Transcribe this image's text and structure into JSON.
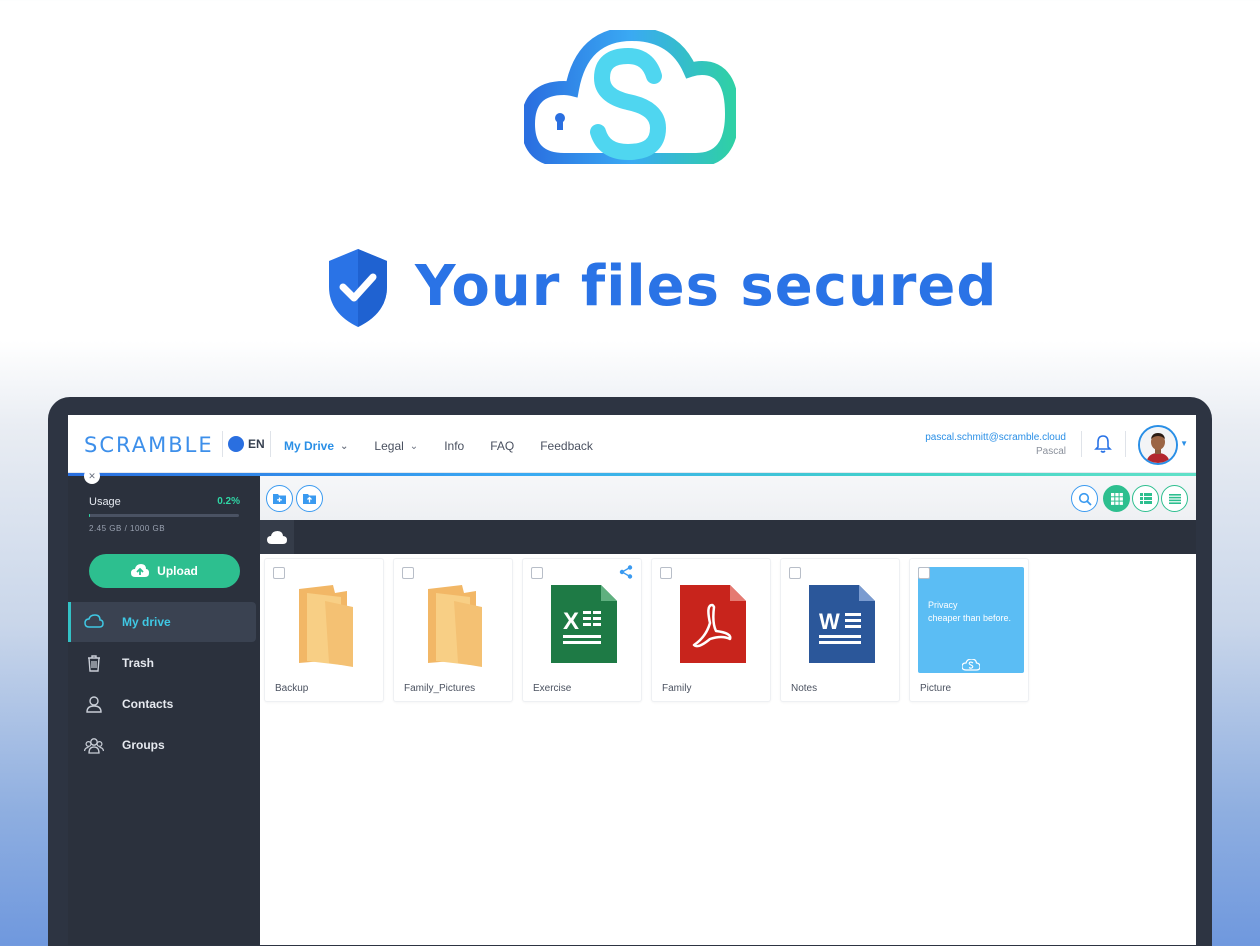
{
  "hero": {
    "title": "Your files secured"
  },
  "topbar": {
    "brand": "SCRAMBLE",
    "language": "EN",
    "nav": [
      {
        "label": "My Drive",
        "active": true,
        "dropdown": true
      },
      {
        "label": "Legal",
        "active": false,
        "dropdown": true
      },
      {
        "label": "Info",
        "active": false,
        "dropdown": false
      },
      {
        "label": "FAQ",
        "active": false,
        "dropdown": false
      },
      {
        "label": "Feedback",
        "active": false,
        "dropdown": false
      }
    ],
    "user_email": "pascal.schmitt@scramble.cloud",
    "user_name": "Pascal"
  },
  "sidebar": {
    "usage_label": "Usage",
    "usage_percent": "0.2%",
    "usage_fraction": 0.002,
    "usage_size": "2.45 GB / 1000 GB",
    "upload_label": "Upload",
    "items": [
      {
        "label": "My drive",
        "icon": "cloud-icon",
        "active": true
      },
      {
        "label": "Trash",
        "icon": "trash-icon",
        "active": false
      },
      {
        "label": "Contacts",
        "icon": "user-icon",
        "active": false
      },
      {
        "label": "Groups",
        "icon": "group-icon",
        "active": false
      }
    ]
  },
  "files": [
    {
      "name": "Backup",
      "type": "folder",
      "icon": "folder-icon"
    },
    {
      "name": "Family_Pictures",
      "type": "folder",
      "icon": "folder-icon"
    },
    {
      "name": "Exercise",
      "type": "excel",
      "icon": "excel-icon",
      "shared": true
    },
    {
      "name": "Family",
      "type": "pdf",
      "icon": "pdf-icon"
    },
    {
      "name": "Notes",
      "type": "word",
      "icon": "word-icon"
    },
    {
      "name": "Picture",
      "type": "image",
      "icon": "image-thumb"
    }
  ],
  "picture_text": {
    "line1": "Privacy",
    "line2": "cheaper than before."
  },
  "colors": {
    "accent": "#2a8fe6",
    "brand_blue": "#2a73e6",
    "green": "#2dbf8f",
    "sidebar": "#2b313d"
  }
}
